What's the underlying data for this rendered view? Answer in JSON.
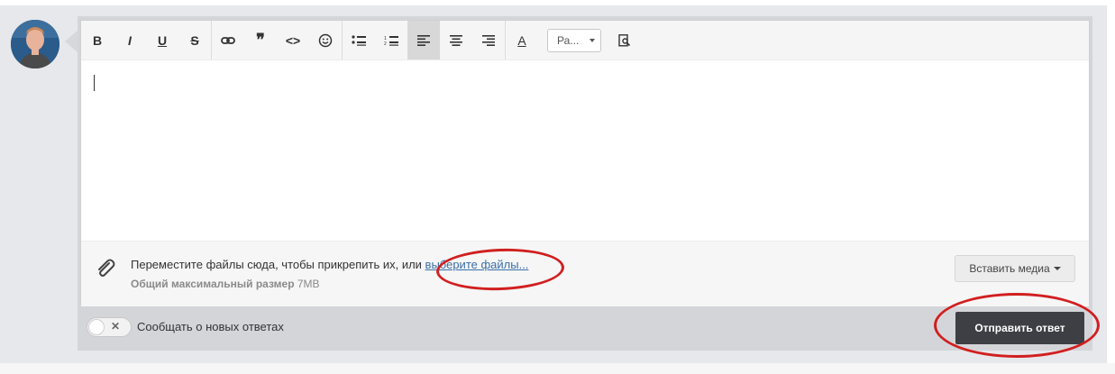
{
  "toolbar": {
    "buttons": [
      {
        "name": "bold-button",
        "glyph": "B"
      },
      {
        "name": "italic-button",
        "glyph": "I"
      },
      {
        "name": "underline-button",
        "glyph": "U"
      },
      {
        "name": "strikethrough-button",
        "glyph": "S"
      },
      {
        "name": "link-button",
        "glyph": "⛓"
      },
      {
        "name": "quote-button",
        "glyph": "❞"
      },
      {
        "name": "code-button",
        "glyph": "<>"
      },
      {
        "name": "emoji-button",
        "glyph": "☺"
      },
      {
        "name": "bullet-list-button",
        "glyph": "☰"
      },
      {
        "name": "numbered-list-button",
        "glyph": "☰"
      },
      {
        "name": "align-left-button",
        "glyph": "≡"
      },
      {
        "name": "align-center-button",
        "glyph": "≡"
      },
      {
        "name": "align-right-button",
        "glyph": "≡"
      },
      {
        "name": "font-color-button",
        "glyph": "A"
      }
    ],
    "size_select": "Ра...",
    "preview_glyph": "🔍"
  },
  "attach": {
    "drop_text": "Переместите файлы сюда, чтобы прикрепить их, или ",
    "choose_link": "выберите файлы...",
    "max_label": "Общий максимальный размер",
    "max_value": " 7MB",
    "insert_media": "Вставить медиа"
  },
  "footer": {
    "notify_label": "Сообщать о новых ответах",
    "submit_label": "Отправить ответ"
  },
  "colors": {
    "annotation": "#d11f1f",
    "submit_bg": "#3d3f44",
    "link": "#3a6fa8"
  }
}
